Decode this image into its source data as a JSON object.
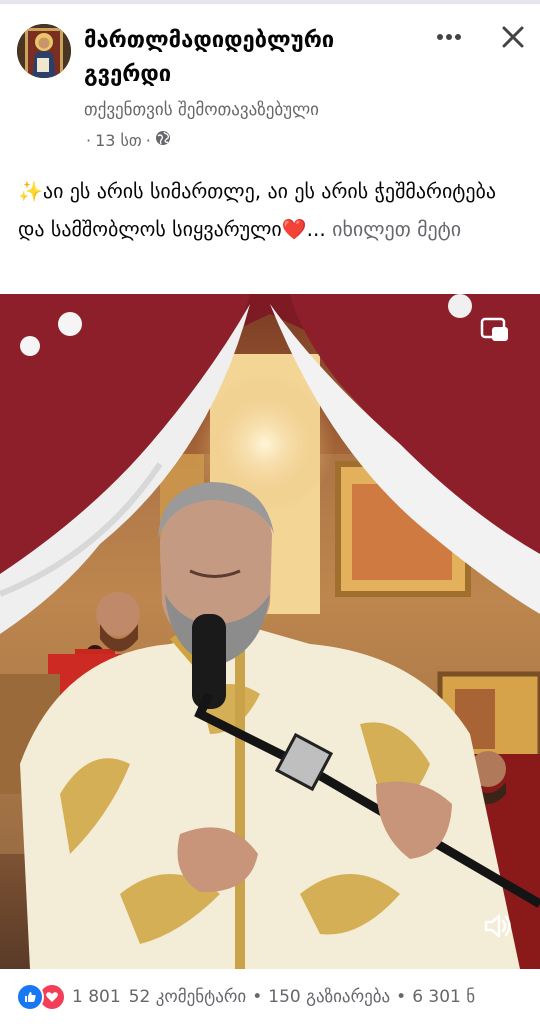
{
  "post": {
    "page_name": "მართლმადიდებლური გვერდი",
    "sponsored_label": "თქვენთვის შემოთავაზებული",
    "time": "13 სთ",
    "meta_dot": "·",
    "caption": {
      "sparkles_emoji": "✨",
      "text": "აი ეს არის სიმართლე, აი ეს არის ჭეშმარიტება და სამშობლოს სიყვარული",
      "heart_emoji": "❤️",
      "ellipsis": "...",
      "see_more": "იხილეთ მეტი"
    }
  },
  "footer": {
    "reaction_count": "1 801",
    "comments": "52 კომენტარი",
    "separator": "•",
    "shares": "150 გაზიარება",
    "views": "6 301 ნ"
  },
  "colors": {
    "text_primary": "#050505",
    "text_secondary": "#65676b",
    "like_blue": "#1877f2",
    "love_red": "#f33e58"
  },
  "icons": {
    "more": "more-horizontal-icon",
    "close": "close-icon",
    "audience": "globe-icon",
    "pip": "picture-in-picture-icon",
    "volume": "volume-icon",
    "like": "like-reaction-icon",
    "love": "love-reaction-icon"
  }
}
